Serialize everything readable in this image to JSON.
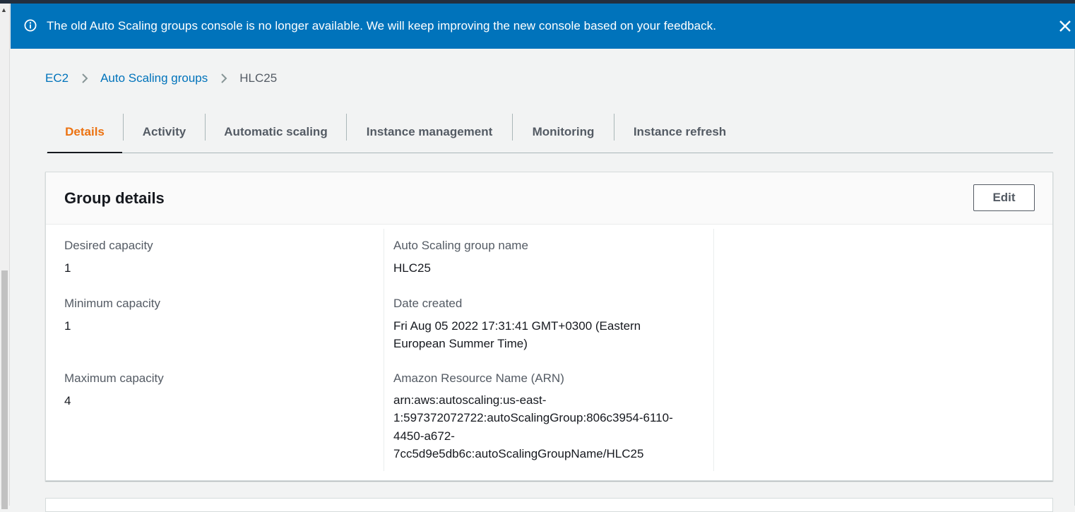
{
  "flash": {
    "message": "The old Auto Scaling groups console is no longer available. We will keep improving the new console based on your feedback.",
    "icon": "info-icon",
    "close_icon": "close-icon",
    "background": "#0073bb"
  },
  "breadcrumb": {
    "items": [
      "EC2",
      "Auto Scaling groups",
      "HLC25"
    ]
  },
  "tabs": [
    {
      "label": "Details",
      "active": true
    },
    {
      "label": "Activity",
      "active": false
    },
    {
      "label": "Automatic scaling",
      "active": false
    },
    {
      "label": "Instance management",
      "active": false
    },
    {
      "label": "Monitoring",
      "active": false
    },
    {
      "label": "Instance refresh",
      "active": false
    }
  ],
  "group_details": {
    "title": "Group details",
    "edit_label": "Edit",
    "desired_capacity": {
      "label": "Desired capacity",
      "value": "1"
    },
    "minimum_capacity": {
      "label": "Minimum capacity",
      "value": "1"
    },
    "maximum_capacity": {
      "label": "Maximum capacity",
      "value": "4"
    },
    "group_name": {
      "label": "Auto Scaling group name",
      "value": "HLC25"
    },
    "date_created": {
      "label": "Date created",
      "line1": "Fri Aug 05 2022 17:31:41 GMT+0300 (Eastern",
      "line2": "European Summer Time)"
    },
    "arn": {
      "label": "Amazon Resource Name (ARN)",
      "line1": "arn:aws:autoscaling:us-east-",
      "line2": "1:597372072722:autoScalingGroup:806c3954-6110-",
      "line3": "4450-a672-",
      "line4": "7cc5d9e5db6c:autoScalingGroupName/HLC25"
    }
  },
  "colors": {
    "accent_tab": "#ec7211",
    "link": "#0073bb"
  }
}
